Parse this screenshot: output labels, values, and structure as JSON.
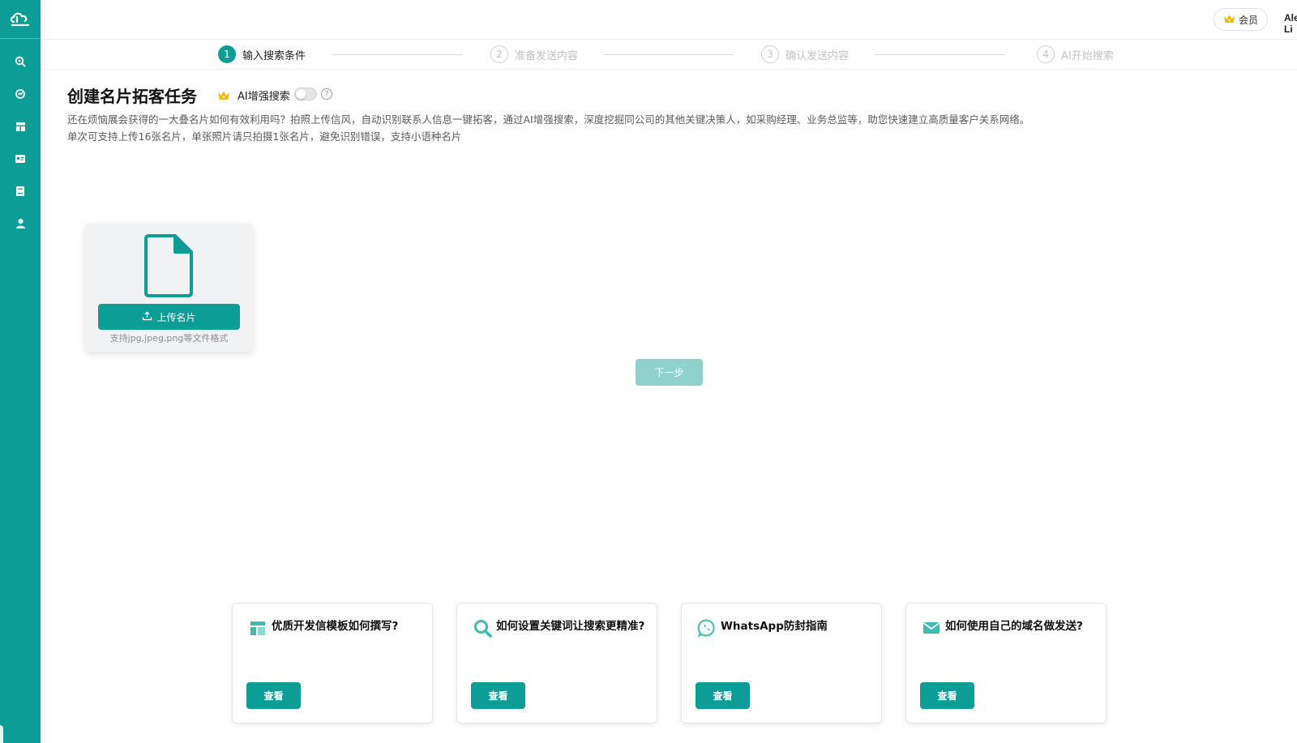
{
  "colors": {
    "primary": "#0c9e96",
    "primary_light": "#8fd1cc",
    "crown": "#f5b800"
  },
  "sidebar": {
    "logo_icon": "cloud-logo-icon",
    "items": [
      {
        "icon": "search-icon"
      },
      {
        "icon": "chart-icon"
      },
      {
        "icon": "layout-icon"
      },
      {
        "icon": "card-icon"
      },
      {
        "icon": "book-icon"
      },
      {
        "icon": "user-icon"
      }
    ]
  },
  "header": {
    "member_label": "会员",
    "user_name": "Alex Li"
  },
  "steps": [
    {
      "num": "1",
      "label": "输入搜索条件",
      "state": "active"
    },
    {
      "num": "2",
      "label": "准备发送内容",
      "state": "inactive"
    },
    {
      "num": "3",
      "label": "确认发送内容",
      "state": "inactive"
    },
    {
      "num": "4",
      "label": "AI开始搜索",
      "state": "inactive"
    }
  ],
  "page": {
    "title": "创建名片拓客任务",
    "ai_label": "AI增强搜索",
    "ai_enabled": false,
    "help_mark": "?",
    "description_line1": "还在烦恼展会获得的一大叠名片如何有效利用吗？拍照上传信风，自动识别联系人信息一键拓客，通过AI增强搜索，深度挖掘同公司的其他关键决策人，如采购经理、业务总监等，助您快速建立高质量客户关系网络。",
    "description_line2": "单次可支持上传16张名片，单张照片请只拍摄1张名片，避免识别错误，支持小语种名片"
  },
  "upload": {
    "button_label": "上传名片",
    "hint": "支持jpg,jpeg,png等文件格式"
  },
  "next_button": "下一步",
  "help_cards": [
    {
      "icon": "template-icon",
      "title": "优质开发信模板如何撰写?",
      "button": "查看"
    },
    {
      "icon": "search-icon",
      "title": "如何设置关键词让搜索更精准?",
      "button": "查看"
    },
    {
      "icon": "whatsapp-icon",
      "title": "WhatsApp防封指南",
      "button": "查看"
    },
    {
      "icon": "mail-icon",
      "title": "如何使用自己的域名做发送?",
      "button": "查看"
    }
  ]
}
